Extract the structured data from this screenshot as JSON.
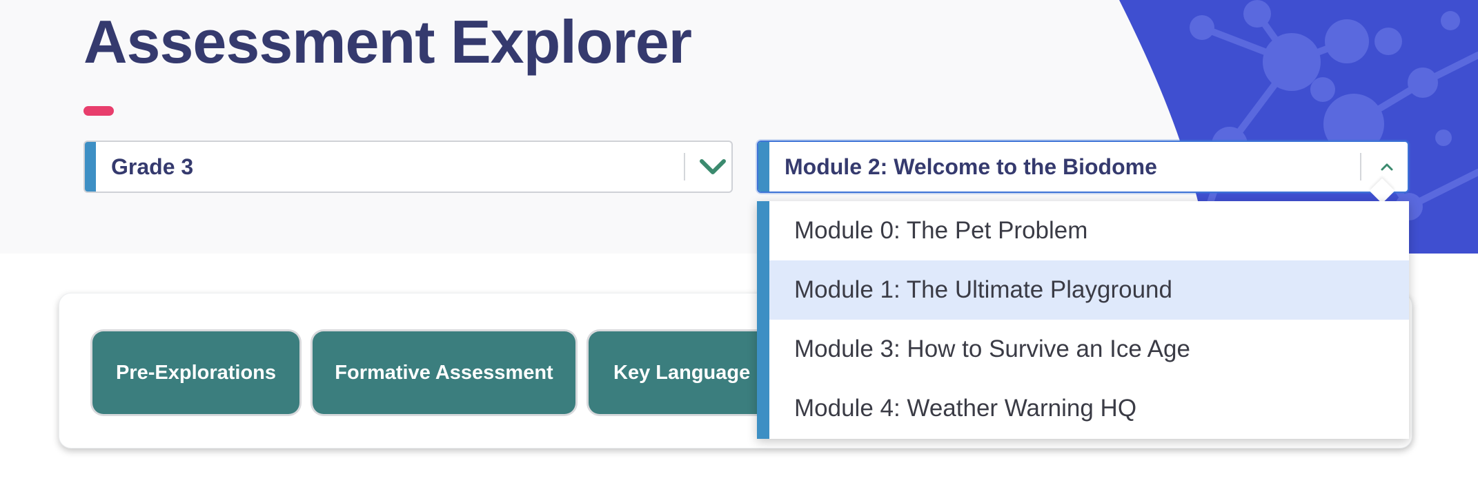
{
  "header": {
    "title": "Assessment Explorer"
  },
  "filters": {
    "grade": {
      "selected": "Grade 3"
    },
    "module": {
      "selected": "Module 2: Welcome to the Biodome",
      "expanded": true,
      "options": [
        {
          "label": "Module 0: The Pet Problem"
        },
        {
          "label": "Module 1: The Ultimate Playground",
          "highlighted": true
        },
        {
          "label": "Module 3: How to Survive an Ice Age"
        },
        {
          "label": "Module 4: Weather Warning HQ"
        }
      ]
    }
  },
  "tabs": [
    {
      "label": "Pre-Explorations"
    },
    {
      "label": "Formative Assessment"
    },
    {
      "label": "Key Language Pr"
    }
  ],
  "icons": {
    "grade_chevron": "chevron-down-icon",
    "module_chevron": "chevron-up-icon"
  },
  "colors": {
    "title": "#353a6e",
    "title_underline": "#e83e6c",
    "select_accent": "#3d8fc4",
    "chevron": "#3b8a6e",
    "tab_background": "#3b7e7e",
    "hero_art": "#3f4fd0",
    "option_highlight": "#dfe9fb"
  }
}
